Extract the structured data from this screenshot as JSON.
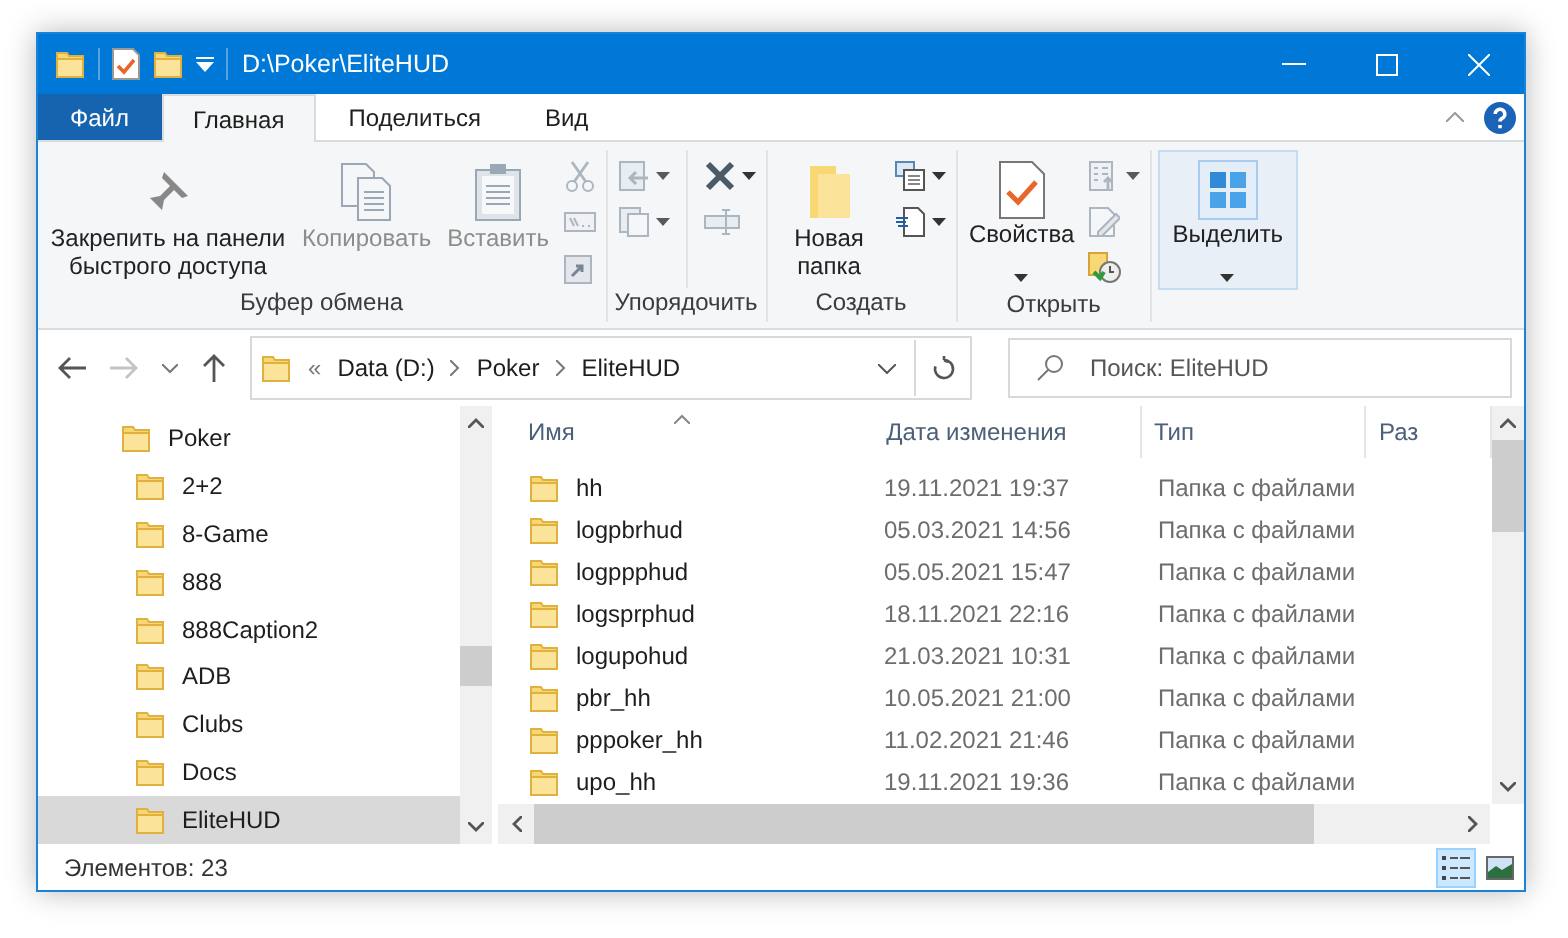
{
  "window": {
    "title": "D:\\Poker\\EliteHUD"
  },
  "ribbon": {
    "tabs": [
      {
        "label": "Файл",
        "kind": "file",
        "selected": false
      },
      {
        "label": "Главная",
        "kind": "tab",
        "selected": true
      },
      {
        "label": "Поделиться",
        "kind": "tab",
        "selected": false
      },
      {
        "label": "Вид",
        "kind": "tab",
        "selected": false
      }
    ],
    "groups": [
      {
        "label": "Буфер обмена",
        "items": [
          {
            "kind": "large",
            "label": "Закрепить на панели быстрого доступа",
            "disabled": false,
            "menu": false
          },
          {
            "kind": "large",
            "label": "Копировать",
            "disabled": true,
            "menu": false
          },
          {
            "kind": "large",
            "label": "Вставить",
            "disabled": true,
            "menu": false
          },
          {
            "kind": "small",
            "disabled": true,
            "menu": false
          },
          {
            "kind": "small",
            "disabled": true,
            "menu": false
          },
          {
            "kind": "small",
            "disabled": true,
            "menu": false
          }
        ]
      },
      {
        "label": "Упорядочить",
        "items": [
          {
            "kind": "small",
            "disabled": true,
            "menu": true
          },
          {
            "kind": "small",
            "disabled": true,
            "menu": true
          },
          {
            "kind": "small",
            "disabled": false,
            "menu": true
          },
          {
            "kind": "small",
            "disabled": true,
            "menu": false
          }
        ]
      },
      {
        "label": "Создать",
        "items": [
          {
            "kind": "large",
            "label": "Новая папка",
            "disabled": false,
            "menu": false
          },
          {
            "kind": "small",
            "disabled": false,
            "menu": true
          },
          {
            "kind": "small",
            "disabled": false,
            "menu": true
          }
        ]
      },
      {
        "label": "Открыть",
        "items": [
          {
            "kind": "large",
            "label": "Свойства",
            "disabled": false,
            "menu": true
          },
          {
            "kind": "small",
            "disabled": true,
            "menu": true
          },
          {
            "kind": "small",
            "disabled": true,
            "menu": false
          },
          {
            "kind": "small",
            "disabled": false,
            "menu": false
          }
        ]
      },
      {
        "items": [
          {
            "kind": "large",
            "label": "Выделить",
            "disabled": false,
            "menu": true,
            "hovered": true
          }
        ]
      }
    ]
  },
  "address": {
    "overflow": "«",
    "crumbs": [
      "Data (D:)",
      "Poker",
      "EliteHUD"
    ]
  },
  "search": {
    "placeholder": "Поиск: EliteHUD"
  },
  "tree": [
    {
      "label": "Poker",
      "selected": false,
      "children": [
        {
          "label": "2+2",
          "selected": false
        },
        {
          "label": "8-Game",
          "selected": false
        },
        {
          "label": "888",
          "selected": false
        },
        {
          "label": "888Caption2",
          "selected": false
        },
        {
          "label": "ADB",
          "selected": false
        },
        {
          "label": "Clubs",
          "selected": false
        },
        {
          "label": "Docs",
          "selected": false
        },
        {
          "label": "EliteHUD",
          "selected": true
        }
      ]
    }
  ],
  "table": {
    "columns": [
      "Имя",
      "Дата изменения",
      "Тип",
      "Раз"
    ],
    "rows": [
      {
        "name": "hh",
        "date": "19.11.2021 19:37",
        "type": "Папка с файлами"
      },
      {
        "name": "logpbrhud",
        "date": "05.03.2021 14:56",
        "type": "Папка с файлами"
      },
      {
        "name": "logppphud",
        "date": "05.05.2021 15:47",
        "type": "Папка с файлами"
      },
      {
        "name": "logsprphud",
        "date": "18.11.2021 22:16",
        "type": "Папка с файлами"
      },
      {
        "name": "logupohud",
        "date": "21.03.2021 10:31",
        "type": "Папка с файлами"
      },
      {
        "name": "pbr_hh",
        "date": "10.05.2021 21:00",
        "type": "Папка с файлами"
      },
      {
        "name": "pppoker_hh",
        "date": "11.02.2021 21:46",
        "type": "Папка с файлами"
      },
      {
        "name": "upo_hh",
        "date": "19.11.2021 19:36",
        "type": "Папка с файлами"
      }
    ]
  },
  "status_bar": {
    "text": "Элементов: 23",
    "views": [
      {
        "kind": "details",
        "selected": true
      },
      {
        "kind": "large-icons",
        "selected": false
      }
    ]
  }
}
